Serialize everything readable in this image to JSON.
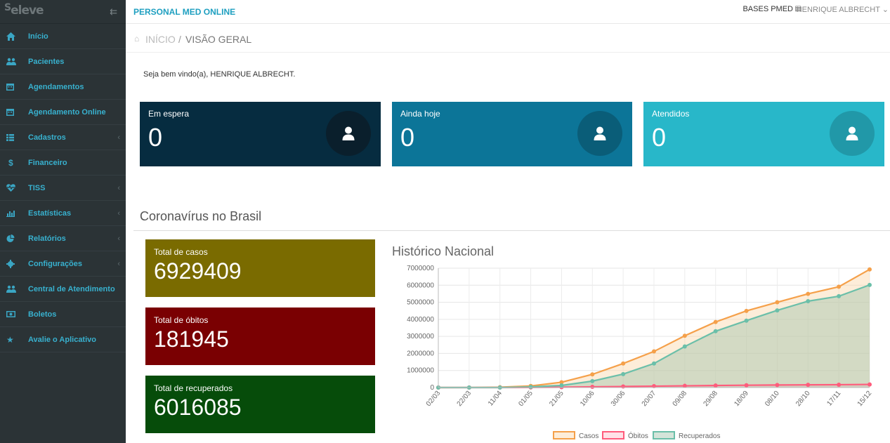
{
  "app": {
    "logo": "eleve",
    "brand": "PERSONAL MED ONLINE",
    "bases_label": "BASES PMED",
    "user_name": "HENRIQUE ALBRECHT"
  },
  "sidebar": {
    "items": [
      {
        "label": "Início",
        "icon": "home-icon"
      },
      {
        "label": "Pacientes",
        "icon": "users-icon"
      },
      {
        "label": "Agendamentos",
        "icon": "calendar-icon"
      },
      {
        "label": "Agendamento Online",
        "icon": "calendar-icon"
      },
      {
        "label": "Cadastros",
        "icon": "list-icon",
        "has_submenu": true
      },
      {
        "label": "Financeiro",
        "icon": "dollar-icon"
      },
      {
        "label": "TISS",
        "icon": "heartbeat-icon",
        "has_submenu": true
      },
      {
        "label": "Estatísticas",
        "icon": "bar-chart-icon",
        "has_submenu": true
      },
      {
        "label": "Relatórios",
        "icon": "pie-chart-icon",
        "has_submenu": true
      },
      {
        "label": "Configurações",
        "icon": "gear-icon",
        "has_submenu": true
      },
      {
        "label": "Central de Atendimento",
        "icon": "users-icon"
      },
      {
        "label": "Boletos",
        "icon": "money-icon"
      },
      {
        "label": "Avalie o Aplicativo",
        "icon": "star-icon"
      }
    ]
  },
  "breadcrumb": {
    "home": "INÍCIO",
    "separator": "/",
    "current": "VISÃO GERAL"
  },
  "welcome": "Seja bem vindo(a), HENRIQUE ALBRECHT.",
  "stats": [
    {
      "title": "Em espera",
      "value": "0",
      "color": "#062c40",
      "circle": "#0a1f2c"
    },
    {
      "title": "Ainda hoje",
      "value": "0",
      "color": "#0c7598",
      "circle": "#0a5d78"
    },
    {
      "title": "Atendidos",
      "value": "0",
      "color": "#28b7c9",
      "circle": "#2198a8"
    }
  ],
  "covid": {
    "title": "Coronavírus no Brasil",
    "cases": {
      "label": "Total de casos",
      "value": "6929409",
      "color": "#7a6b00"
    },
    "deaths": {
      "label": "Total de óbitos",
      "value": "181945",
      "color": "#7a0002"
    },
    "recovered": {
      "label": "Total de recuperados",
      "value": "6016085",
      "color": "#064c0a"
    },
    "chart_title": "Histórico Nacional"
  },
  "chart_data": {
    "type": "line",
    "title": "Histórico Nacional",
    "categories": [
      "02/03",
      "22/03",
      "11/04",
      "01/05",
      "21/05",
      "10/06",
      "30/06",
      "20/07",
      "09/08",
      "29/08",
      "18/09",
      "08/10",
      "28/10",
      "17/11",
      "15/12"
    ],
    "ylim": [
      0,
      7000000
    ],
    "y_ticks": [
      "0",
      "1000000",
      "2000000",
      "3000000",
      "4000000",
      "5000000",
      "6000000",
      "7000000"
    ],
    "series": [
      {
        "name": "Casos",
        "color": "#f5a04a",
        "fill": "rgba(250,215,170,0.45)",
        "values": [
          2,
          1546,
          20727,
          91589,
          310087,
          772416,
          1408485,
          2118646,
          3035422,
          3846153,
          4495183,
          5000694,
          5494376,
          5911758,
          6929409
        ]
      },
      {
        "name": "Óbitos",
        "color": "#ff5c7c",
        "fill": "rgba(255,180,195,0.4)",
        "values": [
          0,
          25,
          1124,
          6329,
          20047,
          39680,
          59594,
          80120,
          100477,
          120262,
          135793,
          148228,
          158456,
          166699,
          181945
        ]
      },
      {
        "name": "Recuperados",
        "color": "#6bbfa9",
        "fill": "rgba(160,195,170,0.45)",
        "values": [
          0,
          2,
          173,
          38039,
          122528,
          376336,
          788318,
          1409202,
          2407005,
          3303352,
          3923594,
          4526393,
          5064344,
          5356876,
          6016085
        ]
      }
    ],
    "legend_position": "bottom"
  }
}
